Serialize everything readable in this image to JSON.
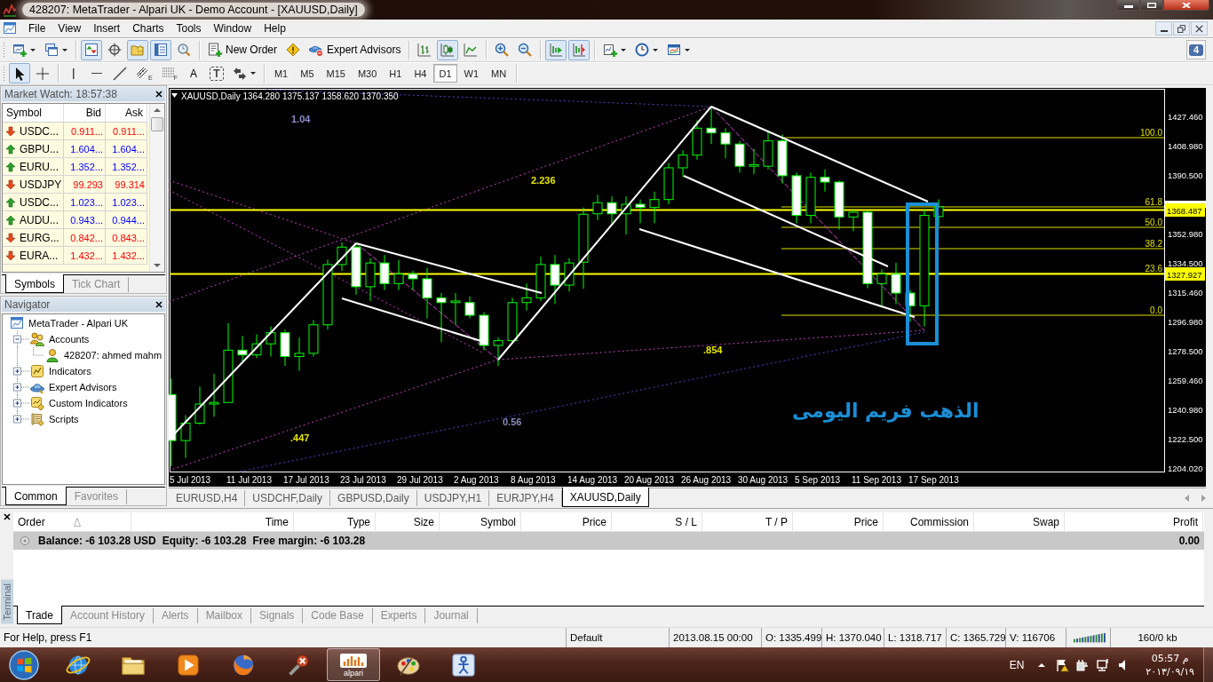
{
  "window": {
    "title": "428207: MetaTrader - Alpari UK - Demo Account - [XAUUSD,Daily]"
  },
  "menu": [
    "File",
    "View",
    "Insert",
    "Charts",
    "Tools",
    "Window",
    "Help"
  ],
  "toolbar": [
    {
      "kind": "new-chart",
      "on": false
    },
    {
      "kind": "profiles",
      "on": false
    },
    {
      "kind": "market-watch",
      "on": true
    },
    {
      "kind": "data-window",
      "on": false
    },
    {
      "kind": "navigator",
      "on": true
    },
    {
      "kind": "terminal",
      "on": true
    },
    {
      "kind": "tester",
      "on": false
    },
    {
      "kind": "new-order",
      "label": "New Order",
      "on": false
    },
    {
      "kind": "warning",
      "on": false
    },
    {
      "kind": "experts",
      "label": "Expert Advisors",
      "on": false
    },
    {
      "kind": "bar-chart",
      "on": false
    },
    {
      "kind": "candles",
      "on": true
    },
    {
      "kind": "line-chart",
      "on": false
    },
    {
      "kind": "zoom-in",
      "on": false
    },
    {
      "kind": "zoom-out",
      "on": false
    },
    {
      "kind": "auto-scroll",
      "on": true
    },
    {
      "kind": "chart-shift",
      "on": true
    },
    {
      "kind": "indicators",
      "on": false
    },
    {
      "kind": "periods",
      "on": false
    },
    {
      "kind": "templates",
      "on": false
    }
  ],
  "messages": {
    "count": "4"
  },
  "drawing_tools": [
    {
      "kind": "cursor",
      "on": true
    },
    {
      "kind": "crosshair",
      "on": false
    },
    {
      "kind": "vertical-line",
      "on": false
    },
    {
      "kind": "horizontal-line",
      "on": false
    },
    {
      "kind": "trend-line",
      "on": false
    },
    {
      "kind": "channel",
      "sub": "E",
      "on": false
    },
    {
      "kind": "fibonacci",
      "sub": "F",
      "on": false
    },
    {
      "kind": "text",
      "glyph": "A",
      "on": false
    },
    {
      "kind": "label",
      "glyph": "T",
      "on": false
    },
    {
      "kind": "arrows",
      "on": false
    }
  ],
  "periods": [
    {
      "label": "M1",
      "selected": false
    },
    {
      "label": "M5",
      "selected": false
    },
    {
      "label": "M15",
      "selected": false
    },
    {
      "label": "M30",
      "selected": false
    },
    {
      "label": "H1",
      "selected": false
    },
    {
      "label": "H4",
      "selected": false
    },
    {
      "label": "D1",
      "selected": true
    },
    {
      "label": "W1",
      "selected": false
    },
    {
      "label": "MN",
      "selected": false
    }
  ],
  "market_watch": {
    "title": "Market Watch: 18:57:38",
    "columns": [
      "Symbol",
      "Bid",
      "Ask"
    ],
    "rows": [
      {
        "symbol": "USDC...",
        "bid": "0.911...",
        "ask": "0.911...",
        "rising": false
      },
      {
        "symbol": "GBPU...",
        "bid": "1.604...",
        "ask": "1.604...",
        "rising": true
      },
      {
        "symbol": "EURU...",
        "bid": "1.352...",
        "ask": "1.352...",
        "rising": true
      },
      {
        "symbol": "USDJPY",
        "bid": "99.293",
        "ask": "99.314",
        "rising": false
      },
      {
        "symbol": "USDC...",
        "bid": "1.023...",
        "ask": "1.023...",
        "rising": true
      },
      {
        "symbol": "AUDU...",
        "bid": "0.943...",
        "ask": "0.944...",
        "rising": true
      },
      {
        "symbol": "EURG...",
        "bid": "0.842...",
        "ask": "0.843...",
        "rising": false
      },
      {
        "symbol": "EURA...",
        "bid": "1.432...",
        "ask": "1.432...",
        "rising": false
      }
    ],
    "tabs": [
      {
        "label": "Symbols",
        "selected": true
      },
      {
        "label": "Tick Chart",
        "selected": false
      }
    ]
  },
  "navigator": {
    "title": "Navigator",
    "tree": [
      {
        "label": "MetaTrader - Alpari UK",
        "kind": "terminal",
        "children": [
          {
            "label": "Accounts",
            "kind": "accounts",
            "expanded": true,
            "children": [
              {
                "label": "428207: ahmed mahm",
                "kind": "account"
              }
            ]
          },
          {
            "label": "Indicators",
            "kind": "indicators",
            "expanded": false
          },
          {
            "label": "Expert Advisors",
            "kind": "experts",
            "expanded": false
          },
          {
            "label": "Custom Indicators",
            "kind": "custom-indicators",
            "expanded": false
          },
          {
            "label": "Scripts",
            "kind": "scripts",
            "expanded": false
          }
        ]
      }
    ],
    "tabs": [
      {
        "label": "Common",
        "selected": true
      },
      {
        "label": "Favorites",
        "selected": false
      }
    ]
  },
  "chart": {
    "header": "XAUUSD,Daily 1364.280 1375.137 1358.620 1370.350",
    "price_labels": [
      "1427.460",
      "1408.980",
      "1390.500",
      "1352.980",
      "1334.500",
      "1315.460",
      "1296.980",
      "1278.500",
      "1259.460",
      "1240.980",
      "1222.500",
      "1204.020"
    ],
    "price_markers": [
      "1368.487",
      "1327.927"
    ],
    "fib_levels": [
      "100.0",
      "61.8",
      "50.0",
      "38.2",
      "23.6",
      "0.0"
    ],
    "fan_labels": [
      {
        "label": "1.04",
        "color": "#8c8cc8"
      },
      {
        "label": "2.236",
        "color": "#e6e600"
      },
      {
        "label": ".854",
        "color": "#e6e600"
      },
      {
        "label": "0.56",
        "color": "#8a8ab8"
      },
      {
        "label": ".447",
        "color": "#e6e600"
      }
    ],
    "date_labels": [
      "5 Jul 2013",
      "11 Jul 2013",
      "17 Jul 2013",
      "23 Jul 2013",
      "29 Jul 2013",
      "2 Aug 2013",
      "8 Aug 2013",
      "14 Aug 2013",
      "20 Aug 2013",
      "26 Aug 2013",
      "30 Aug 2013",
      "5 Sep 2013",
      "11 Sep 2013",
      "17 Sep 2013"
    ],
    "annotation": "الذهب فريم اليومى"
  },
  "chart_tabs": [
    {
      "label": "EURUSD,H4",
      "selected": false
    },
    {
      "label": "USDCHF,Daily",
      "selected": false
    },
    {
      "label": "GBPUSD,Daily",
      "selected": false
    },
    {
      "label": "USDJPY,H1",
      "selected": false
    },
    {
      "label": "EURJPY,H4",
      "selected": false
    },
    {
      "label": "XAUUSD,Daily",
      "selected": true
    }
  ],
  "terminal": {
    "title": "Terminal",
    "columns": [
      {
        "label": "Order",
        "sorted": true
      },
      {
        "label": "Time",
        "sorted": false
      },
      {
        "label": "Type",
        "sorted": false
      },
      {
        "label": "Size",
        "sorted": false
      },
      {
        "label": "Symbol",
        "sorted": false
      },
      {
        "label": "Price",
        "sorted": false
      },
      {
        "label": "S / L",
        "sorted": false
      },
      {
        "label": "T / P",
        "sorted": false
      },
      {
        "label": "Price",
        "sorted": false
      },
      {
        "label": "Commission",
        "sorted": false
      },
      {
        "label": "Swap",
        "sorted": false
      },
      {
        "label": "Profit",
        "sorted": false
      }
    ],
    "summary": {
      "items": [
        "Balance: -6 103.28 USD",
        "Equity: -6 103.28",
        "Free margin: -6 103.28"
      ],
      "profit": "0.00"
    },
    "tabs": [
      {
        "label": "Trade",
        "selected": true
      },
      {
        "label": "Account History",
        "selected": false
      },
      {
        "label": "Alerts",
        "selected": false
      },
      {
        "label": "Mailbox",
        "selected": false
      },
      {
        "label": "Signals",
        "selected": false
      },
      {
        "label": "Code Base",
        "selected": false
      },
      {
        "label": "Experts",
        "selected": false
      },
      {
        "label": "Journal",
        "selected": false
      }
    ]
  },
  "status_bar": {
    "help": "For Help, press F1",
    "profile": "Default",
    "time": "2013.08.15 00:00",
    "open": "O: 1335.499",
    "high": "H: 1370.040",
    "low": "L: 1318.717",
    "close": "C: 1365.729",
    "volume": "V: 116706",
    "traffic": "160/0 kb"
  },
  "taskbar": {
    "apps": [
      {
        "kind": "browser",
        "selected": false
      },
      {
        "kind": "folder",
        "selected": false
      },
      {
        "kind": "media",
        "selected": false
      },
      {
        "kind": "firefox",
        "selected": false
      },
      {
        "kind": "tools",
        "selected": false
      },
      {
        "kind": "alpari",
        "caption": "alpari",
        "selected": true
      },
      {
        "kind": "paint",
        "selected": false
      },
      {
        "kind": "figure",
        "selected": false
      }
    ],
    "language": "EN",
    "time": "05:57 م",
    "date": "٢٠١٣/٠٩/١٩"
  }
}
